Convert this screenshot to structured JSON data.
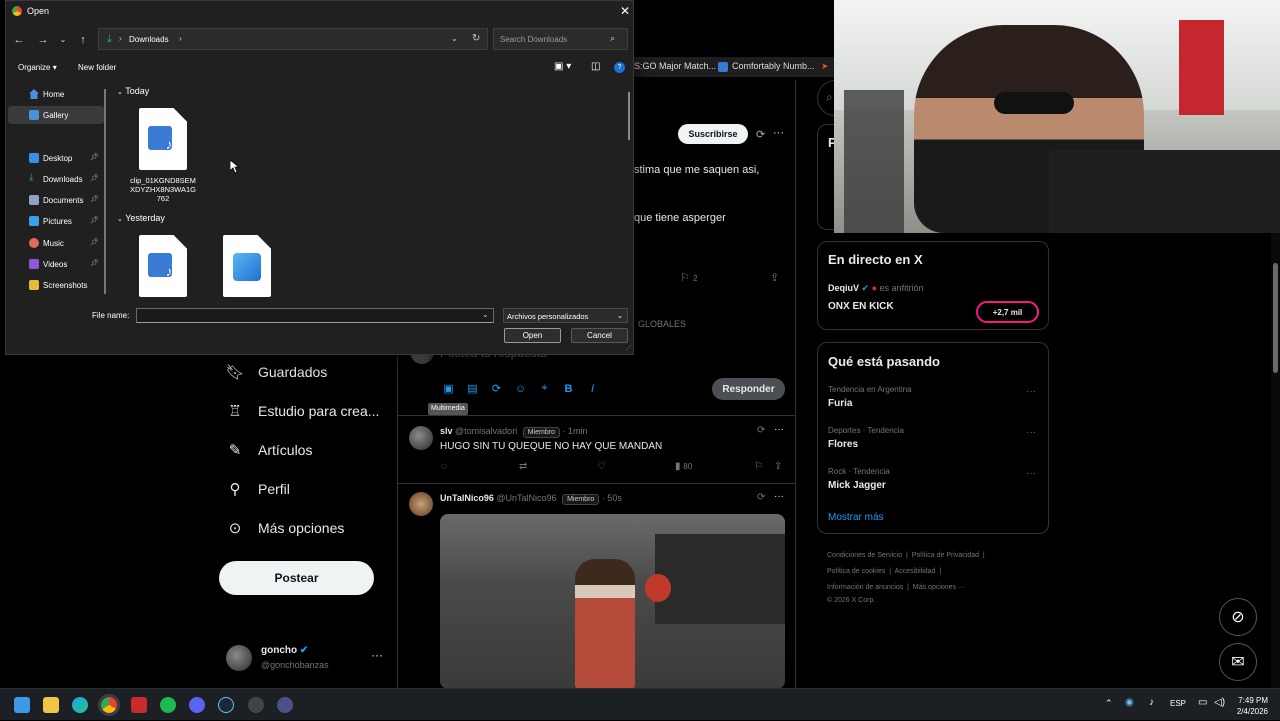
{
  "dialog": {
    "title": "Open",
    "address": "Downloads",
    "search_placeholder": "Search Downloads",
    "organize": "Organize",
    "new_folder": "New folder",
    "sidebar": [
      {
        "label": "Home",
        "color": "#4a90d9",
        "pinned": false
      },
      {
        "label": "Gallery",
        "color": "#4a90d9",
        "pinned": false,
        "active": true
      },
      {
        "label": "Desktop",
        "color": "#3a8ee6",
        "pinned": true
      },
      {
        "label": "Downloads",
        "color": "#2fa86b",
        "pinned": true
      },
      {
        "label": "Documents",
        "color": "#8fa3c4",
        "pinned": true
      },
      {
        "label": "Pictures",
        "color": "#3aa0e8",
        "pinned": true
      },
      {
        "label": "Music",
        "color": "#e06c5a",
        "pinned": true
      },
      {
        "label": "Videos",
        "color": "#8a5ad6",
        "pinned": true
      },
      {
        "label": "Screenshots",
        "color": "#e8b93a",
        "pinned": false
      }
    ],
    "groups": {
      "today": "Today",
      "yesterday": "Yesterday"
    },
    "today_files": [
      {
        "name": "clip_01KGND8SEMXDYZHX8N3WA1G762",
        "icon": "video-audio-file-icon"
      }
    ],
    "yesterday_files": [
      {
        "name": "",
        "icon": "video-audio-file-icon"
      },
      {
        "name": "",
        "icon": "image-file-icon"
      }
    ],
    "file_name_label": "File name:",
    "file_name_value": "",
    "file_type": "Archivos personalizados",
    "open_label": "Open",
    "cancel_label": "Cancel"
  },
  "browser": {
    "bookmarks": [
      "S:GO Major Match...",
      "Comfortably Numb..."
    ],
    "nav": [
      {
        "label": "Guardados",
        "icon": "bookmark-icon"
      },
      {
        "label": "Estudio para crea...",
        "icon": "creator-studio-icon"
      },
      {
        "label": "Artículos",
        "icon": "article-icon"
      },
      {
        "label": "Perfil",
        "icon": "person-icon"
      },
      {
        "label": "Más opciones",
        "icon": "more-options-icon"
      }
    ],
    "post_button": "Postear",
    "profile": {
      "name": "goncho",
      "handle": "@gonchobanzas"
    },
    "subscribe": "Suscribirse",
    "post_lines": [
      "stima que me saquen asi,",
      "que tiene asperger"
    ],
    "bookmark_count": "2",
    "globales": "GLOBALES",
    "reply_placeholder": "Postea tu respuesta",
    "reply_button": "Responder",
    "tooltip": "Multimedia",
    "tweets": [
      {
        "name": "slv",
        "handle": "@tomisalvadori",
        "badge": "Miembro",
        "time": "· 1min",
        "text": "HUGO SIN TU QUEQUE NO HAY QUE MANDAN",
        "views": "80"
      },
      {
        "name": "UnTalNico96",
        "handle": "@UnTalNico96",
        "badge": "Miembro",
        "time": "· 50s",
        "text": ""
      }
    ],
    "live": {
      "title": "En directo en X",
      "host": "DeqiuV",
      "host_suffix": "es anfitrión",
      "stream": "ONX EN KICK",
      "viewers": "+2,7 mil"
    },
    "trends": {
      "title": "Qué está pasando",
      "items": [
        {
          "category": "Tendencia en Argentina",
          "name": "Furia"
        },
        {
          "category": "Deportes · Tendencia",
          "name": "Flores"
        },
        {
          "category": "Rock · Tendencia",
          "name": "Mick Jagger"
        }
      ],
      "show_more": "Mostrar más"
    },
    "footer": {
      "line1": [
        "Condiciones de Servicio",
        "Política de Privacidad"
      ],
      "line2": [
        "Política de cookies",
        "Accesibilidad"
      ],
      "line3": [
        "Información de anuncios",
        "Más opciones ···"
      ],
      "copyright": "© 2026 X Corp."
    },
    "accent": "#1d9bf0"
  },
  "taskbar": {
    "lang": "ESP",
    "time": "7:49 PM",
    "date": "2/4/2026"
  }
}
